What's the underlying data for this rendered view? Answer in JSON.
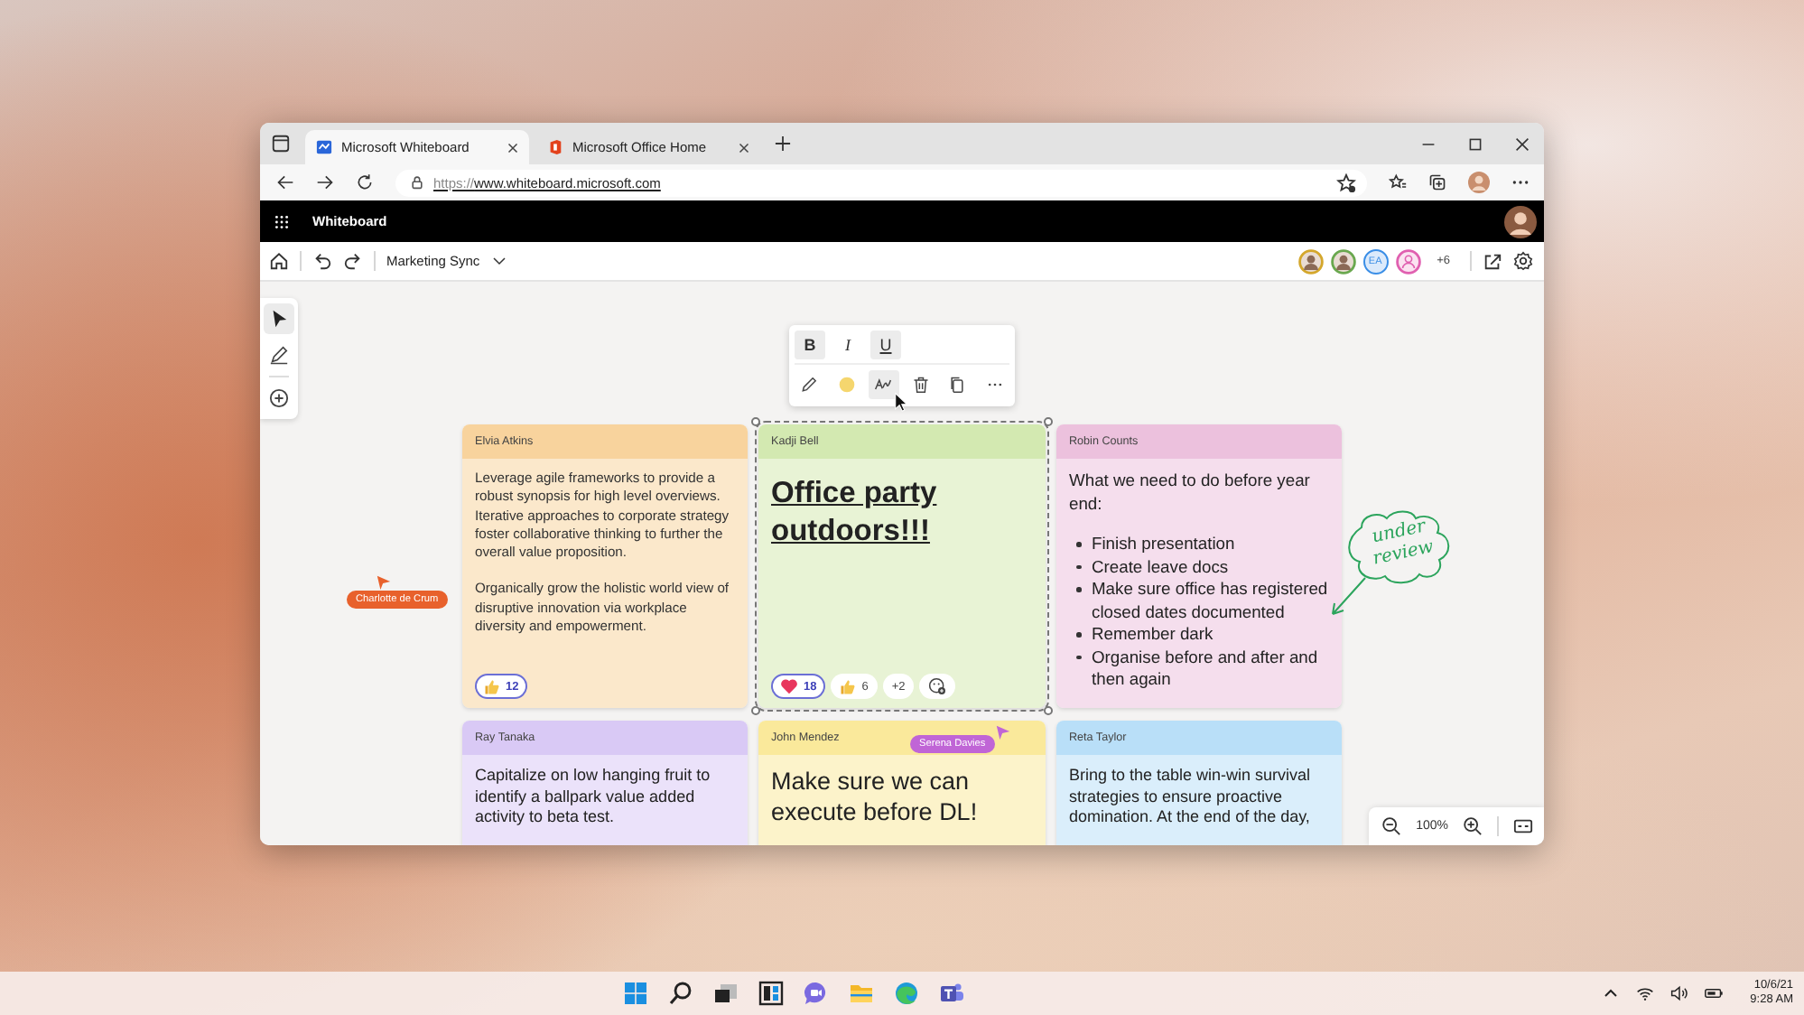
{
  "browser": {
    "tabs": [
      {
        "title": "Microsoft Whiteboard",
        "selected": true
      },
      {
        "title": "Microsoft Office Home",
        "selected": false
      }
    ],
    "url": {
      "scheme": "https://",
      "rest": "www.whiteboard.microsoft.com"
    }
  },
  "app_bar": {
    "title": "Whiteboard"
  },
  "toolbar": {
    "board_name": "Marketing Sync",
    "collaborators": [
      {
        "kind": "photo",
        "color": "#d4a72c"
      },
      {
        "kind": "photo",
        "color": "#6aa84f"
      },
      {
        "kind": "initials",
        "initials": "EA",
        "color": "#3a8ee6"
      },
      {
        "kind": "icon",
        "color": "#e060b0"
      }
    ],
    "more_count": "+6"
  },
  "tools": [
    {
      "kind": "select",
      "selected": true
    },
    {
      "kind": "pen",
      "selected": false
    },
    {
      "kind": "add",
      "selected": false
    }
  ],
  "format_toolbar": {
    "text_styles": [
      {
        "kind": "bold",
        "label": "B",
        "selected": true
      },
      {
        "kind": "italic",
        "label": "I",
        "selected": false
      },
      {
        "kind": "underline",
        "label": "U",
        "selected": true
      }
    ],
    "actions": [
      {
        "kind": "pen",
        "selected": false
      },
      {
        "kind": "color",
        "color": "#f5d66e",
        "selected": false
      },
      {
        "kind": "ink",
        "selected": true
      },
      {
        "kind": "delete",
        "selected": false
      },
      {
        "kind": "copy",
        "selected": false
      },
      {
        "kind": "more",
        "selected": false
      }
    ]
  },
  "notes": [
    {
      "author": "Elvia Atkins",
      "color": "#f8d39d",
      "kind": "paragraphs",
      "selected": false,
      "paragraphs": [
        "Leverage agile frameworks to provide a robust synopsis for high level overviews. Iterative approaches to corporate strategy foster collaborative thinking to further the overall value proposition.",
        "Organically grow the holistic world view of disruptive innovation via workplace diversity and empowerment."
      ],
      "reactions": [
        {
          "kind": "thumb",
          "count": "12",
          "selected": true
        }
      ]
    },
    {
      "author": "Kadji Bell",
      "color": "#d3e9b1",
      "kind": "heading",
      "selected": true,
      "text": "Office party outdoors!!!",
      "reactions": [
        {
          "kind": "heart",
          "count": "18",
          "selected": true
        },
        {
          "kind": "thumb",
          "count": "6",
          "selected": false
        },
        {
          "kind": "more",
          "count": "+2",
          "selected": false
        },
        {
          "kind": "add",
          "selected": false
        }
      ]
    },
    {
      "author": "Robin Counts",
      "color": "#ecc1dd",
      "kind": "list",
      "selected": false,
      "intro": "What we need to do before year end:",
      "items": [
        "Finish presentation",
        "Create leave docs",
        "Make sure office has registered closed dates documented",
        "Remember dark",
        "Organise before and after and then again"
      ],
      "annotation": "under review"
    },
    {
      "author": "Ray Tanaka",
      "color": "#d9c9f5",
      "kind": "text",
      "selected": false,
      "text": "Capitalize on low hanging fruit to identify a ballpark value added activity to beta test."
    },
    {
      "author": "John Mendez",
      "color": "#fae99b",
      "kind": "large",
      "selected": false,
      "text": "Make sure we can execute before DL!"
    },
    {
      "author": "Reta Taylor",
      "color": "#b9dff8",
      "kind": "text",
      "selected": false,
      "text": "Bring to the table win-win survival strategies to ensure proactive domination. At the end of the day,"
    }
  ],
  "cursors": [
    {
      "name": "Charlotte de Crum",
      "color": "#e8612c"
    },
    {
      "name": "Serena Davies",
      "color": "#c065d6"
    }
  ],
  "zoom": {
    "value": "100%"
  },
  "taskbar": {
    "apps": [
      {
        "kind": "start"
      },
      {
        "kind": "search"
      },
      {
        "kind": "taskview"
      },
      {
        "kind": "widgets"
      },
      {
        "kind": "chat"
      },
      {
        "kind": "explorer"
      },
      {
        "kind": "edge"
      },
      {
        "kind": "teams"
      }
    ],
    "date": "10/6/21",
    "time": "9:28 AM"
  }
}
